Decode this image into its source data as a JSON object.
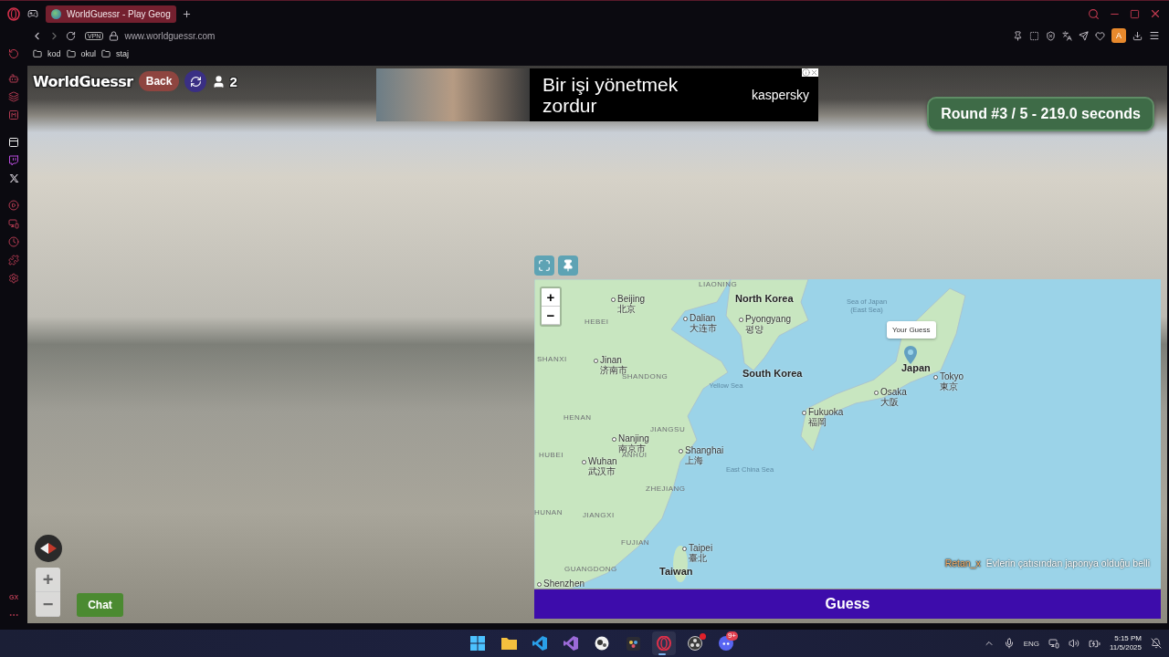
{
  "browser": {
    "tab": {
      "title": "WorldGuessr - Play Geog",
      "selected": true
    },
    "vpn": "VPN",
    "url": "www.worldguessr.com",
    "bookmarks": [
      "kod",
      "okul",
      "staj"
    ],
    "profile": "A"
  },
  "sidebar": {
    "footer": "GX"
  },
  "game": {
    "logo": "WorldGuessr",
    "back": "Back",
    "players": "2",
    "round": "Round #3 / 5 - 219.0 seconds",
    "chat": "Chat",
    "guess": "Guess"
  },
  "ad": {
    "headline": "Bir işi yönetmek zordur",
    "brand": "kaspersky"
  },
  "map": {
    "zoom_in": "+",
    "zoom_out": "−",
    "guess_label": "Your Guess",
    "labels": [
      {
        "kind": "region",
        "name": "LIAONING"
      },
      {
        "kind": "city",
        "name": "Beijing",
        "local": "北京"
      },
      {
        "kind": "country",
        "name": "North Korea"
      },
      {
        "kind": "sea",
        "name": "Sea of Japan (East Sea)"
      },
      {
        "kind": "region",
        "name": "HEBEI"
      },
      {
        "kind": "city",
        "name": "Dalian",
        "local": "大连市"
      },
      {
        "kind": "city",
        "name": "Pyongyang",
        "local": "평양"
      },
      {
        "kind": "region",
        "name": "SHANXI"
      },
      {
        "kind": "city",
        "name": "Jinan",
        "local": "济南市"
      },
      {
        "kind": "region",
        "name": "SHANDONG"
      },
      {
        "kind": "sea",
        "name": "Yellow Sea"
      },
      {
        "kind": "country",
        "name": "South Korea"
      },
      {
        "kind": "country",
        "name": "Japan"
      },
      {
        "kind": "city",
        "name": "Tokyo",
        "local": "東京"
      },
      {
        "kind": "city",
        "name": "Osaka",
        "local": "大阪"
      },
      {
        "kind": "region",
        "name": "HENAN"
      },
      {
        "kind": "city",
        "name": "Fukuoka",
        "local": "福岡"
      },
      {
        "kind": "region",
        "name": "JIANGSU"
      },
      {
        "kind": "city",
        "name": "Nanjing",
        "local": "南京市"
      },
      {
        "kind": "region",
        "name": "HUBEI"
      },
      {
        "kind": "city",
        "name": "Wuhan",
        "local": "武汉市"
      },
      {
        "kind": "region",
        "name": "ANHUI"
      },
      {
        "kind": "city",
        "name": "Shanghai",
        "local": "上海"
      },
      {
        "kind": "sea",
        "name": "East China Sea"
      },
      {
        "kind": "region",
        "name": "ZHEJIANG"
      },
      {
        "kind": "region",
        "name": "HUNAN"
      },
      {
        "kind": "region",
        "name": "JIANGXI"
      },
      {
        "kind": "region",
        "name": "FUJIAN"
      },
      {
        "kind": "city",
        "name": "Taipei",
        "local": "臺北"
      },
      {
        "kind": "region",
        "name": "GUANGDONG"
      },
      {
        "kind": "country",
        "name": "Taiwan"
      },
      {
        "kind": "city",
        "name": "Shenzhen"
      }
    ],
    "chat_message": {
      "user": "Retan_x",
      "text": "Evlerin çatısından japonya olduğu belli"
    }
  },
  "streetview": {
    "zoom_in": "+",
    "zoom_out": "−"
  },
  "taskbar": {
    "apps": [
      {
        "kind": "start",
        "active": false
      },
      {
        "kind": "files",
        "active": false
      },
      {
        "kind": "vscode",
        "active": false
      },
      {
        "kind": "visualstudio",
        "active": false
      },
      {
        "kind": "ball",
        "active": false
      },
      {
        "kind": "resolve",
        "active": false
      },
      {
        "kind": "opera",
        "active": true
      },
      {
        "kind": "obs",
        "active": false,
        "notification": true
      },
      {
        "kind": "discord",
        "active": false,
        "badge": "9+"
      }
    ],
    "language": "ENG",
    "time": "5:15 PM",
    "date": "11/5/2025"
  }
}
